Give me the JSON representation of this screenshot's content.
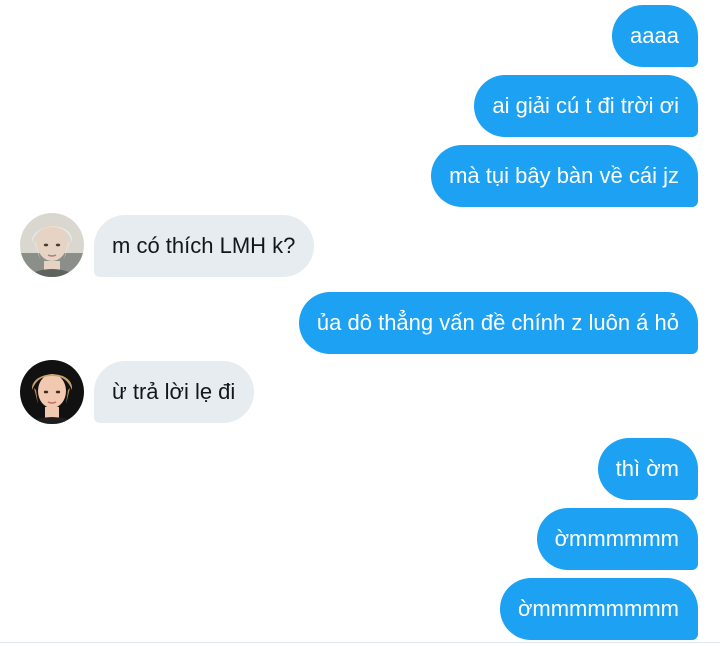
{
  "conversation": {
    "messages": [
      {
        "direction": "outgoing",
        "text": "aaaa"
      },
      {
        "direction": "outgoing",
        "text": "ai giải cú t đi trời ơi"
      },
      {
        "direction": "outgoing",
        "text": "mà tụi bây bàn về cái jz"
      },
      {
        "direction": "incoming",
        "text": "m có thích LMH k?",
        "avatar": "blonde-avatar"
      },
      {
        "direction": "outgoing",
        "text": "ủa dô thẳng vấn đề chính z luôn á hỏ"
      },
      {
        "direction": "incoming",
        "text": "ừ trả lời lẹ đi",
        "avatar": "dark-avatar"
      },
      {
        "direction": "outgoing",
        "text": "thì ờm"
      },
      {
        "direction": "outgoing",
        "text": "ờmmmmmm"
      },
      {
        "direction": "outgoing",
        "text": "ờmmmmmmmm"
      }
    ]
  },
  "colors": {
    "outgoing_bubble": "#1da1f2",
    "incoming_bubble": "#e6ecf0",
    "outgoing_text": "#ffffff",
    "incoming_text": "#14171a"
  }
}
